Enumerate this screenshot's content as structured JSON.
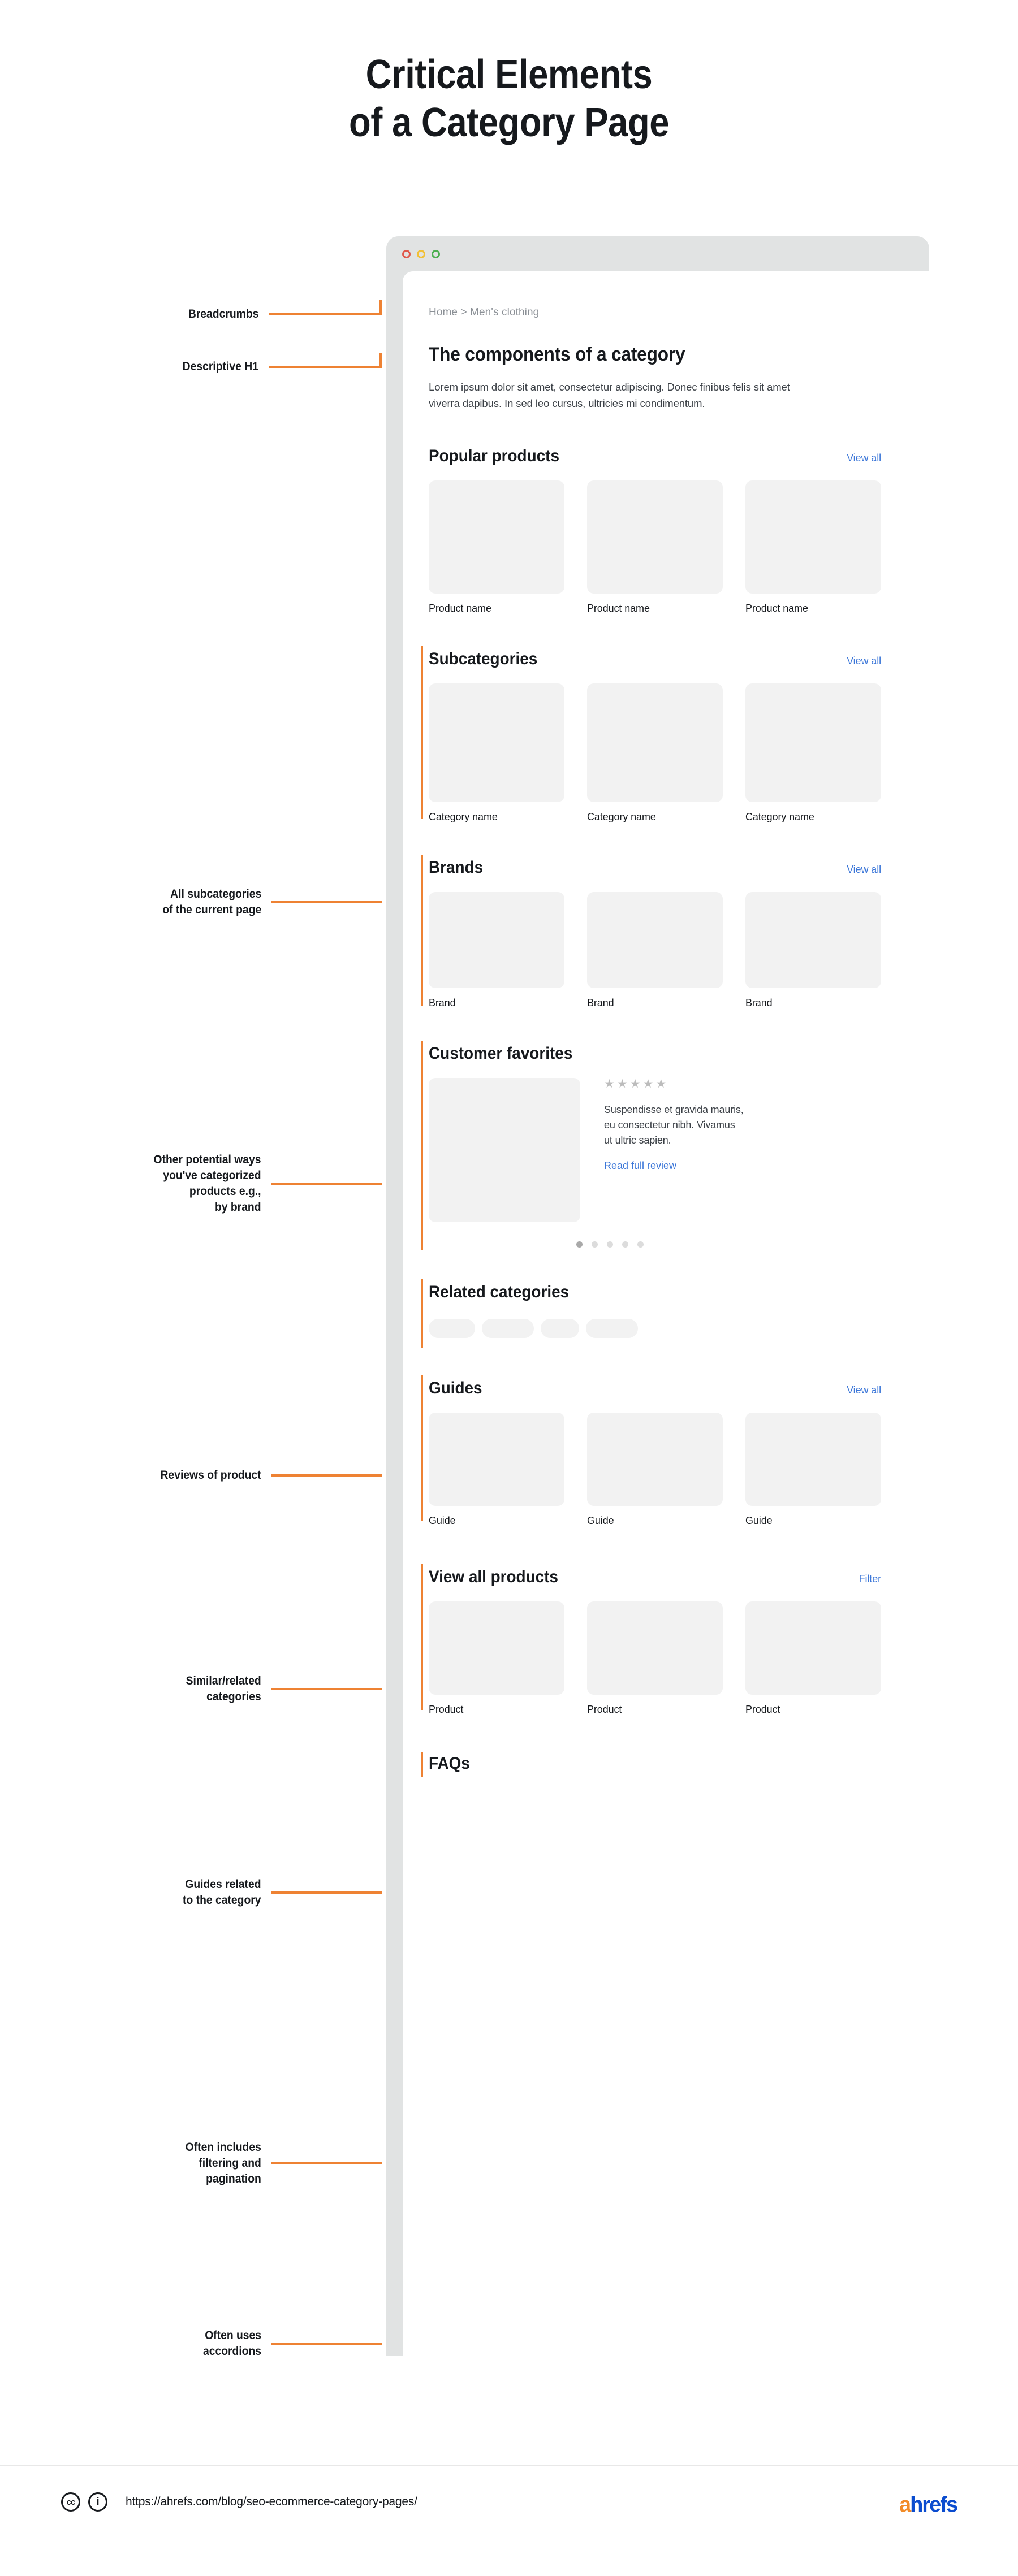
{
  "title": {
    "line1": "Critical Elements",
    "line2": "of a Category Page"
  },
  "window": {
    "dots": [
      "close-red",
      "minimize-yellow",
      "maximize-green"
    ]
  },
  "page": {
    "breadcrumb": "Home > Men's clothing",
    "h1": "The components of a category",
    "lead": "Lorem ipsum dolor sit amet, consectetur adipiscing. Donec finibus felis sit amet viverra dapibus. In sed leo cursus, ultricies mi condimentum.",
    "sections": {
      "popular": {
        "title": "Popular products",
        "link": "View all",
        "cards": [
          "Product name",
          "Product name",
          "Product name"
        ]
      },
      "subcategories": {
        "title": "Subcategories",
        "link": "View all",
        "cards": [
          "Category name",
          "Category name",
          "Category name"
        ]
      },
      "brands": {
        "title": "Brands",
        "link": "View all",
        "cards": [
          "Brand",
          "Brand",
          "Brand"
        ]
      },
      "favorites": {
        "title": "Customer favorites",
        "stars": 5,
        "star_glyph": "★",
        "review_text": "Suspendisse et gravida mauris, eu consectetur nibh. Vivamus ut ultric sapien.",
        "review_link": "Read full review",
        "carousel_dots": 5,
        "carousel_active_index": 0
      },
      "related": {
        "title": "Related categories",
        "pills": 4
      },
      "guides": {
        "title": "Guides",
        "link": "View all",
        "cards": [
          "Guide",
          "Guide",
          "Guide"
        ]
      },
      "all_products": {
        "title": "View all products",
        "link": "Filter",
        "cards": [
          "Product",
          "Product",
          "Product"
        ]
      },
      "faqs": {
        "title": "FAQs"
      }
    }
  },
  "annotations": [
    {
      "id": "breadcrumbs",
      "label": "Breadcrumbs"
    },
    {
      "id": "descriptive-h1",
      "label": "Descriptive H1"
    },
    {
      "id": "subcategories",
      "label": "All subcategories\nof the current page"
    },
    {
      "id": "brands",
      "label": "Other potential ways\nyou've categorized\nproducts e.g.,\nby brand"
    },
    {
      "id": "reviews",
      "label": "Reviews of product"
    },
    {
      "id": "related",
      "label": "Similar/related\ncategories"
    },
    {
      "id": "guides",
      "label": "Guides related\nto the category"
    },
    {
      "id": "filtering",
      "label": "Often includes\nfiltering and\npagination"
    },
    {
      "id": "accordions",
      "label": "Often uses\naccordions"
    }
  ],
  "footer": {
    "license_cc": "cc",
    "license_by": "i",
    "url": "https://ahrefs.com/blog/seo-ecommerce-category-pages/",
    "logo_a": "a",
    "logo_rest": "hrefs"
  },
  "colors": {
    "accent_orange": "#ee8233",
    "link_blue": "#3b76d8",
    "card_gray": "#f2f2f2",
    "chrome_gray": "#e1e3e3",
    "brand_orange": "#f28c28",
    "brand_blue": "#0b4ccf"
  }
}
